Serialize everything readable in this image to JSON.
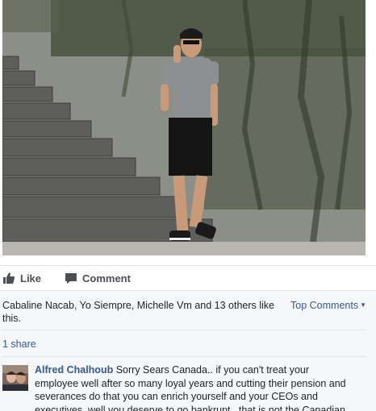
{
  "post": {
    "photo_alt": "photo"
  },
  "actions": {
    "like_label": "Like",
    "comment_label": "Comment"
  },
  "feedback": {
    "likes_text": "Cabaline Nacab, Yo Siempre, Michelle Vm and 13 others like this.",
    "top_comments_label": "Top Comments",
    "shares_text": "1 share"
  },
  "comment": {
    "author": "Alfred Chalhoub",
    "text": "Sorry Sears Canada.. if you can't treat your employee well after so many loyal years and cutting their pension and severances do that you can enrich yourself and your CEOs and executives, well you deserve to go bankrupt.. that is not the Canadian way of doing things."
  },
  "colors": {
    "link": "#365899",
    "action_text": "#4b4f56",
    "feedback_bg": "#f6f7f9"
  },
  "icons": {
    "like": "thumbs-up-icon",
    "comment": "speech-bubble-icon",
    "top_comments_caret": "caret-down-icon"
  }
}
